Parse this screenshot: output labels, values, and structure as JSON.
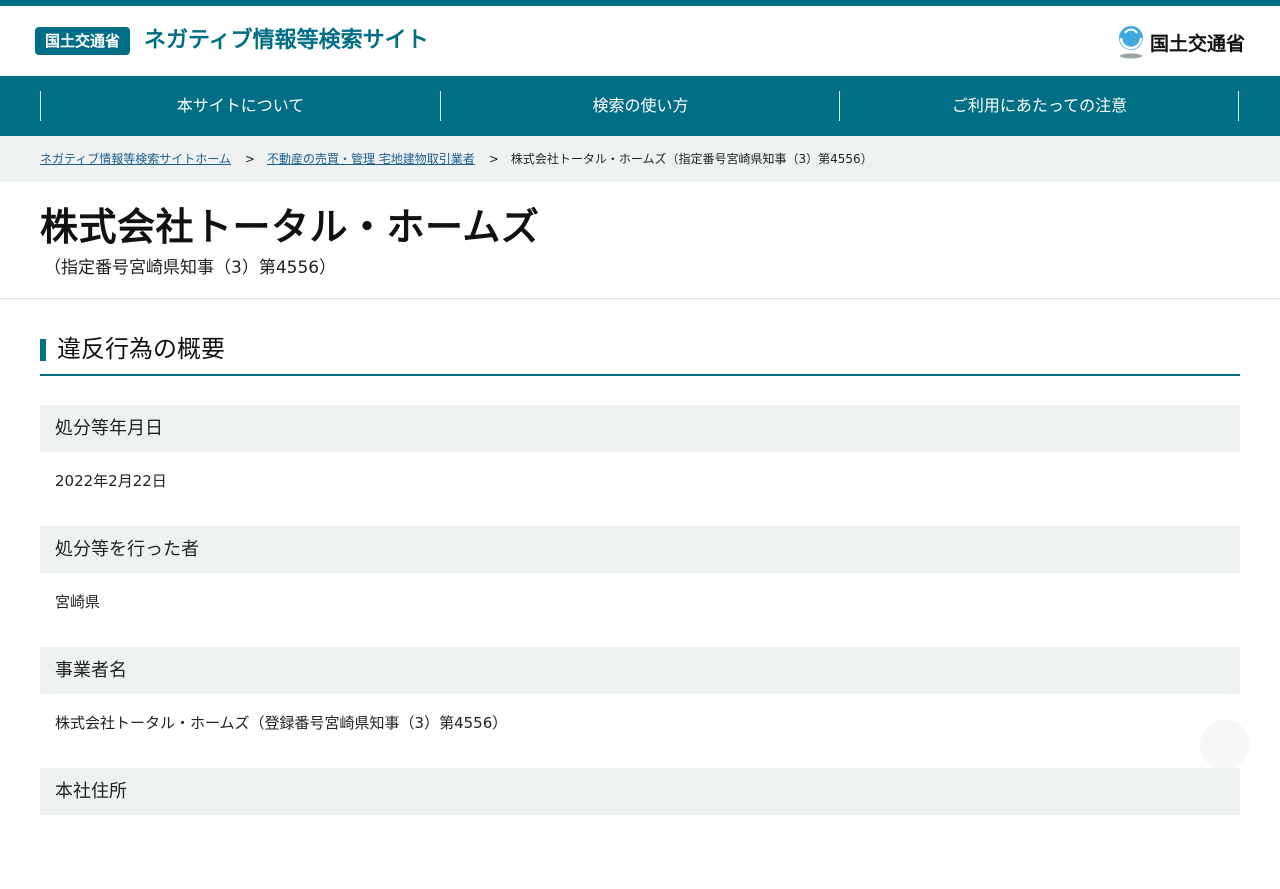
{
  "header": {
    "badge": "国土交通省",
    "site_title": "ネガティブ情報等検索サイト",
    "logo_text": "国土交通省",
    "logo_icon": "mlit-logo-icon",
    "brand_color": "#006e85"
  },
  "nav": {
    "items": [
      {
        "label": "本サイトについて"
      },
      {
        "label": "検索の使い方"
      },
      {
        "label": "ご利用にあたっての注意"
      }
    ]
  },
  "breadcrumb": {
    "home": "ネガティブ情報等検索サイトホーム",
    "category": "不動産の売買・管理 宅地建物取引業者",
    "current": "株式会社トータル・ホームズ（指定番号宮崎県知事（3）第4556）",
    "separator": ">"
  },
  "page": {
    "title": "株式会社トータル・ホームズ",
    "subtitle": "（指定番号宮崎県知事（3）第4556）"
  },
  "section": {
    "heading": "違反行為の概要"
  },
  "details": [
    {
      "label": "処分等年月日",
      "value": "2022年2月22日"
    },
    {
      "label": "処分等を行った者",
      "value": "宮崎県"
    },
    {
      "label": "事業者名",
      "value": "株式会社トータル・ホームズ（登録番号宮崎県知事（3）第4556）"
    },
    {
      "label": "本社住所",
      "value": ""
    }
  ]
}
